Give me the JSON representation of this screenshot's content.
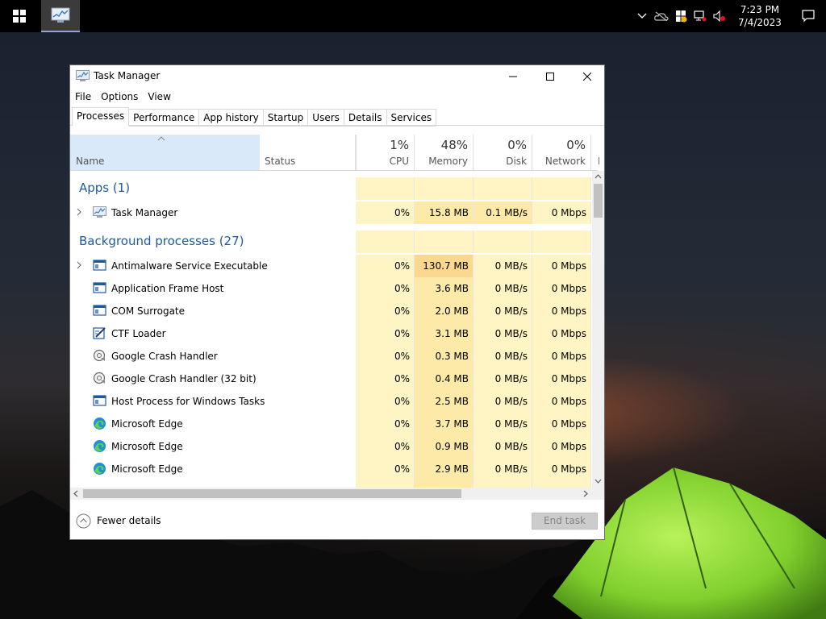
{
  "taskbar": {
    "time": "7:23 PM",
    "date": "7/4/2023"
  },
  "window": {
    "title": "Task Manager",
    "menu": [
      "File",
      "Options",
      "View"
    ],
    "tabs": [
      "Processes",
      "Performance",
      "App history",
      "Startup",
      "Users",
      "Details",
      "Services"
    ],
    "active_tab": "Processes"
  },
  "columns": {
    "name": "Name",
    "status": "Status",
    "cpu": {
      "percent": "1%",
      "label": "CPU"
    },
    "memory": {
      "percent": "48%",
      "label": "Memory"
    },
    "disk": {
      "percent": "0%",
      "label": "Disk"
    },
    "network": {
      "percent": "0%",
      "label": "Network"
    },
    "power": "P"
  },
  "groups": {
    "apps": "Apps (1)",
    "background": "Background processes (27)"
  },
  "apps": [
    {
      "name": "Task Manager",
      "icon": "task-manager-icon",
      "expandable": true,
      "cpu": "0%",
      "memory": "15.8 MB",
      "disk": "0.1 MB/s",
      "network": "0 Mbps"
    }
  ],
  "background": [
    {
      "name": "Antimalware Service Executable",
      "icon": "window-app-icon",
      "expandable": true,
      "cpu": "0%",
      "memory": "130.7 MB",
      "disk": "0 MB/s",
      "network": "0 Mbps"
    },
    {
      "name": "Application Frame Host",
      "icon": "window-app-icon",
      "expandable": false,
      "cpu": "0%",
      "memory": "3.6 MB",
      "disk": "0 MB/s",
      "network": "0 Mbps"
    },
    {
      "name": "COM Surrogate",
      "icon": "window-app-icon",
      "expandable": false,
      "cpu": "0%",
      "memory": "2.0 MB",
      "disk": "0 MB/s",
      "network": "0 Mbps"
    },
    {
      "name": "CTF Loader",
      "icon": "ctf-loader-icon",
      "expandable": false,
      "cpu": "0%",
      "memory": "3.1 MB",
      "disk": "0 MB/s",
      "network": "0 Mbps"
    },
    {
      "name": "Google Crash Handler",
      "icon": "crash-handler-icon",
      "expandable": false,
      "cpu": "0%",
      "memory": "0.3 MB",
      "disk": "0 MB/s",
      "network": "0 Mbps"
    },
    {
      "name": "Google Crash Handler (32 bit)",
      "icon": "crash-handler-icon",
      "expandable": false,
      "cpu": "0%",
      "memory": "0.4 MB",
      "disk": "0 MB/s",
      "network": "0 Mbps"
    },
    {
      "name": "Host Process for Windows Tasks",
      "icon": "window-app-icon",
      "expandable": false,
      "cpu": "0%",
      "memory": "2.5 MB",
      "disk": "0 MB/s",
      "network": "0 Mbps"
    },
    {
      "name": "Microsoft Edge",
      "icon": "edge-icon",
      "expandable": false,
      "cpu": "0%",
      "memory": "3.7 MB",
      "disk": "0 MB/s",
      "network": "0 Mbps"
    },
    {
      "name": "Microsoft Edge",
      "icon": "edge-icon",
      "expandable": false,
      "cpu": "0%",
      "memory": "0.9 MB",
      "disk": "0 MB/s",
      "network": "0 Mbps"
    },
    {
      "name": "Microsoft Edge",
      "icon": "edge-icon",
      "expandable": false,
      "cpu": "0%",
      "memory": "2.9 MB",
      "disk": "0 MB/s",
      "network": "0 Mbps"
    }
  ],
  "footer": {
    "fewer_details": "Fewer details",
    "end_task": "End task"
  }
}
